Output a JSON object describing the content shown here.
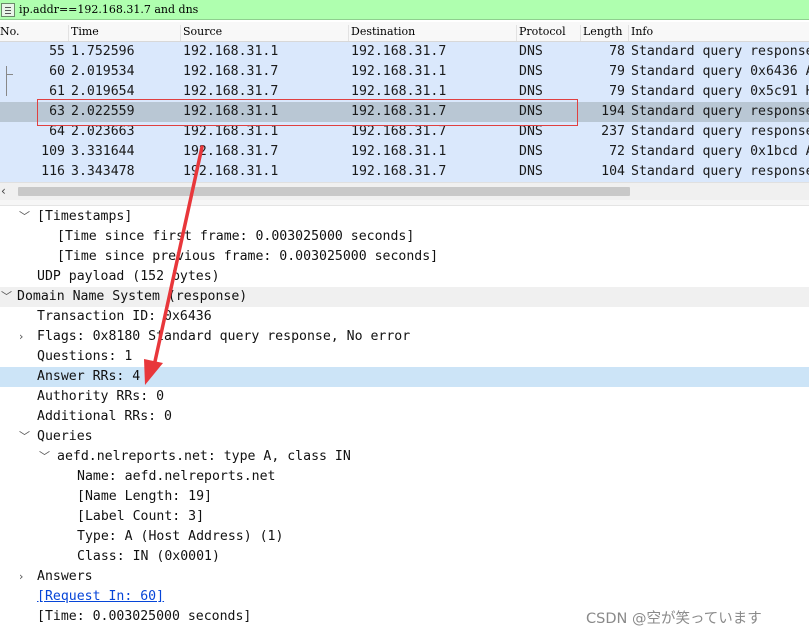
{
  "filter": {
    "value": "ip.addr==192.168.31.7 and dns"
  },
  "columns": [
    "No.",
    "Time",
    "Source",
    "Destination",
    "Protocol",
    "Length",
    "Info"
  ],
  "packets": [
    {
      "no": "55",
      "time": "1.752596",
      "src": "192.168.31.1",
      "dst": "192.168.31.7",
      "proto": "DNS",
      "len": "78",
      "info": "Standard query response"
    },
    {
      "no": "60",
      "time": "2.019534",
      "src": "192.168.31.7",
      "dst": "192.168.31.1",
      "proto": "DNS",
      "len": "79",
      "info": "Standard query 0x6436 A"
    },
    {
      "no": "61",
      "time": "2.019654",
      "src": "192.168.31.7",
      "dst": "192.168.31.1",
      "proto": "DNS",
      "len": "79",
      "info": "Standard query 0x5c91 H"
    },
    {
      "no": "63",
      "time": "2.022559",
      "src": "192.168.31.1",
      "dst": "192.168.31.7",
      "proto": "DNS",
      "len": "194",
      "info": "Standard query response"
    },
    {
      "no": "64",
      "time": "2.023663",
      "src": "192.168.31.1",
      "dst": "192.168.31.7",
      "proto": "DNS",
      "len": "237",
      "info": "Standard query response"
    },
    {
      "no": "109",
      "time": "3.331644",
      "src": "192.168.31.7",
      "dst": "192.168.31.1",
      "proto": "DNS",
      "len": "72",
      "info": "Standard query 0x1bcd A"
    },
    {
      "no": "116",
      "time": "3.343478",
      "src": "192.168.31.1",
      "dst": "192.168.31.7",
      "proto": "DNS",
      "len": "104",
      "info": "Standard query response"
    }
  ],
  "tree": {
    "timestamps": "[Timestamps]",
    "time_first": "[Time since first frame: 0.003025000 seconds]",
    "time_prev": "[Time since previous frame: 0.003025000 seconds]",
    "udp_payload": "UDP payload (152 bytes)",
    "dns": "Domain Name System (response)",
    "txid": "Transaction ID: 0x6436",
    "flags": "Flags: 0x8180 Standard query response, No error",
    "questions": "Questions: 1",
    "answer_rrs": "Answer RRs: 4",
    "authority_rrs": "Authority RRs: 0",
    "additional_rrs": "Additional RRs: 0",
    "queries": "Queries",
    "query": "aefd.nelreports.net: type A, class IN",
    "q_name": "Name: aefd.nelreports.net",
    "q_name_len": "[Name Length: 19]",
    "q_label_count": "[Label Count: 3]",
    "q_type": "Type: A (Host Address) (1)",
    "q_class": "Class: IN (0x0001)",
    "answers": "Answers",
    "request_in": "[Request In: 60]",
    "time": "[Time: 0.003025000 seconds]"
  },
  "watermark": "CSDN @空が笑っています",
  "colors": {
    "filter_ok": "#afffaf",
    "row_bg": "#dae8fc",
    "row_selected": "#b9c7d4",
    "highlight": "#cce4f7",
    "annotation": "#e8373b"
  },
  "icons": [
    "filter-bookmark-icon",
    "expand-arrow-icon",
    "collapse-arrow-icon",
    "scroll-left-arrow-icon",
    "related-packet-bracket-icon"
  ]
}
